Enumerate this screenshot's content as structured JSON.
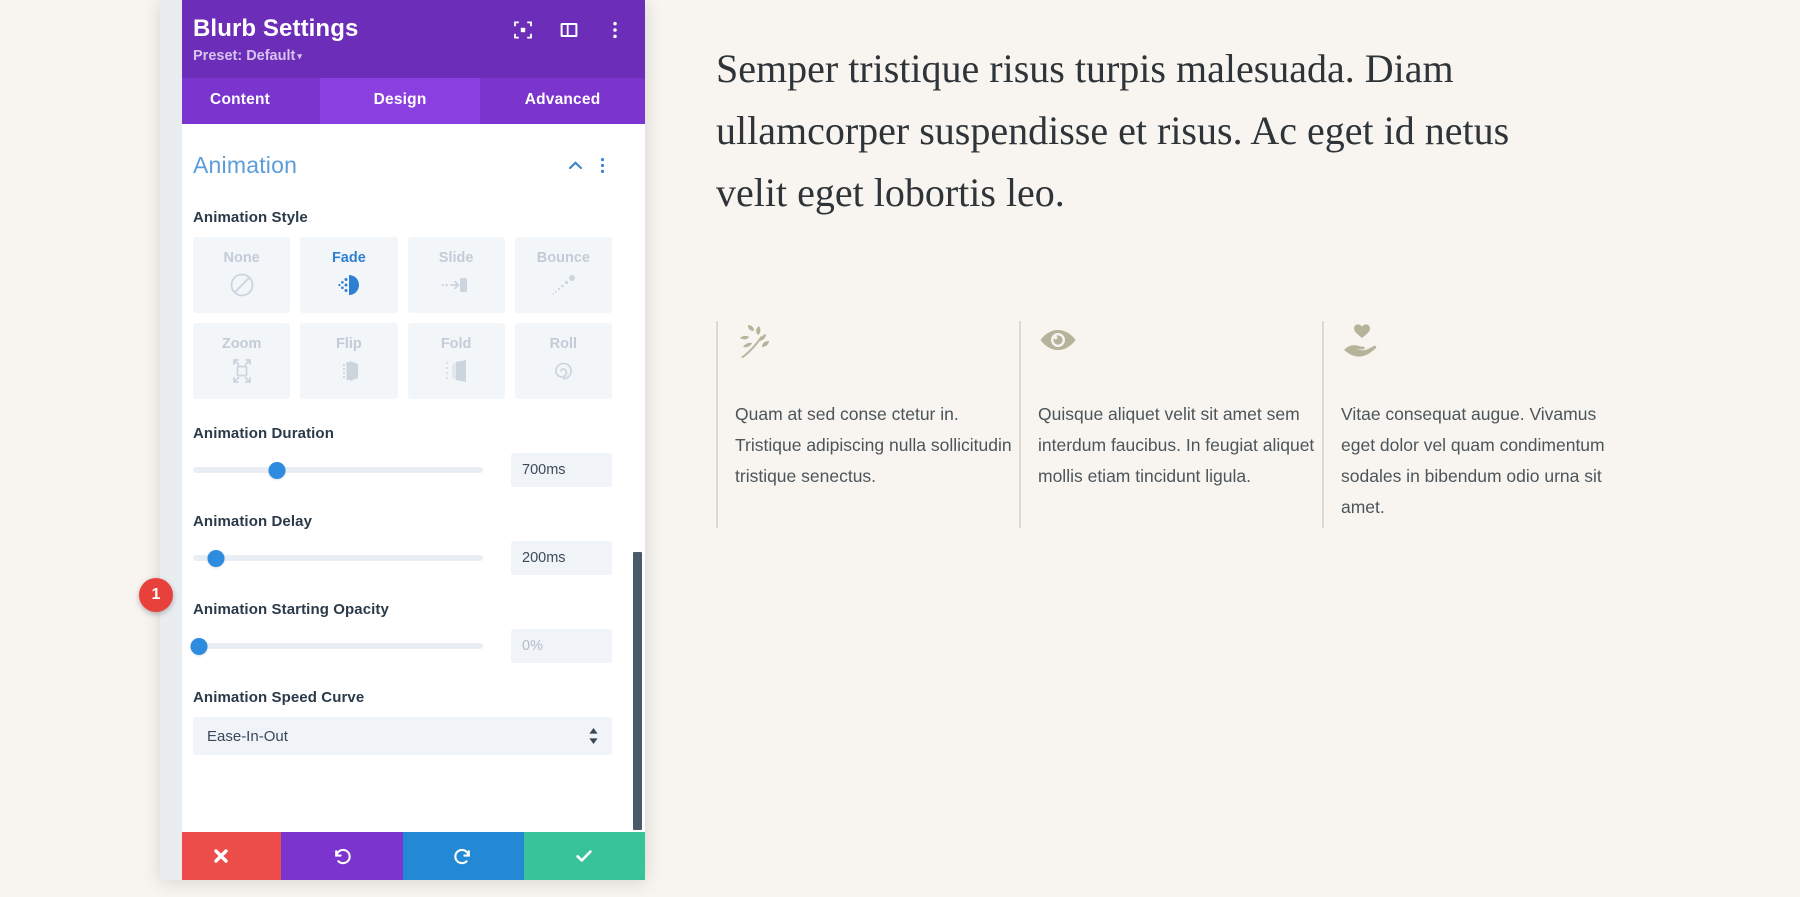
{
  "panel": {
    "title": "Blurb Settings",
    "preset": "Preset: Default",
    "preset_caret": "▾",
    "header_icons": [
      {
        "name": "focus-icon"
      },
      {
        "name": "panel-layout-icon"
      },
      {
        "name": "more-options-icon"
      }
    ],
    "tabs": [
      {
        "label": "Content",
        "active": false
      },
      {
        "label": "Design",
        "active": true
      },
      {
        "label": "Advanced",
        "active": false
      }
    ],
    "section": {
      "title": "Animation",
      "collapse_icon": "chevron-up-icon",
      "options_icon": "more-options-icon"
    },
    "fields": {
      "animation_style_label": "Animation Style",
      "animation_styles": [
        {
          "label": "None",
          "icon": "none-icon",
          "active": false
        },
        {
          "label": "Fade",
          "icon": "fade-icon",
          "active": true
        },
        {
          "label": "Slide",
          "icon": "slide-icon",
          "active": false
        },
        {
          "label": "Bounce",
          "icon": "bounce-icon",
          "active": false
        },
        {
          "label": "Zoom",
          "icon": "zoom-icon",
          "active": false
        },
        {
          "label": "Flip",
          "icon": "flip-icon",
          "active": false
        },
        {
          "label": "Fold",
          "icon": "fold-icon",
          "active": false
        },
        {
          "label": "Roll",
          "icon": "roll-icon",
          "active": false
        }
      ],
      "duration_label": "Animation Duration",
      "duration_value": "700ms",
      "duration_percent": 29,
      "delay_label": "Animation Delay",
      "delay_value": "200ms",
      "delay_percent": 8,
      "opacity_label": "Animation Starting Opacity",
      "opacity_value": "0%",
      "opacity_percent": 2,
      "speed_curve_label": "Animation Speed Curve",
      "speed_curve_value": "Ease-In-Out"
    },
    "footer": [
      {
        "name": "cancel-button",
        "icon": "close-icon"
      },
      {
        "name": "undo-button",
        "icon": "undo-icon"
      },
      {
        "name": "redo-button",
        "icon": "redo-icon"
      },
      {
        "name": "save-button",
        "icon": "check-icon"
      }
    ]
  },
  "annotation": {
    "badge": "1"
  },
  "content": {
    "heading": "Semper tristique risus turpis malesuada. Diam ullamcorper suspendisse et risus. Ac eget id netus velit eget lobortis leo.",
    "blurbs": [
      {
        "icon": "leaf-icon",
        "text": "Quam at sed conse ctetur in. Tristique adipiscing nulla sollicitudin tristique senectus."
      },
      {
        "icon": "eye-icon",
        "text": "Quisque aliquet velit sit amet sem interdum faucibus. In feugiat aliquet mollis etiam tincidunt ligula."
      },
      {
        "icon": "heart-hand-icon",
        "text": "Vitae consequat augue. Vivamus eget dolor vel quam condimentum sodales in bibendum odio urna sit amet."
      }
    ]
  },
  "colors": {
    "page_bg": "#f8f5f1",
    "header_purple": "#6c2eb9",
    "tab_purple": "#7b34cd",
    "tab_active_purple": "#8a40e0",
    "accent_blue": "#2d8ce0",
    "section_blue": "#5b9dd9",
    "badge_red": "#e8413c",
    "save_green": "#38c39a",
    "icon_sage": "#b5b39a"
  }
}
